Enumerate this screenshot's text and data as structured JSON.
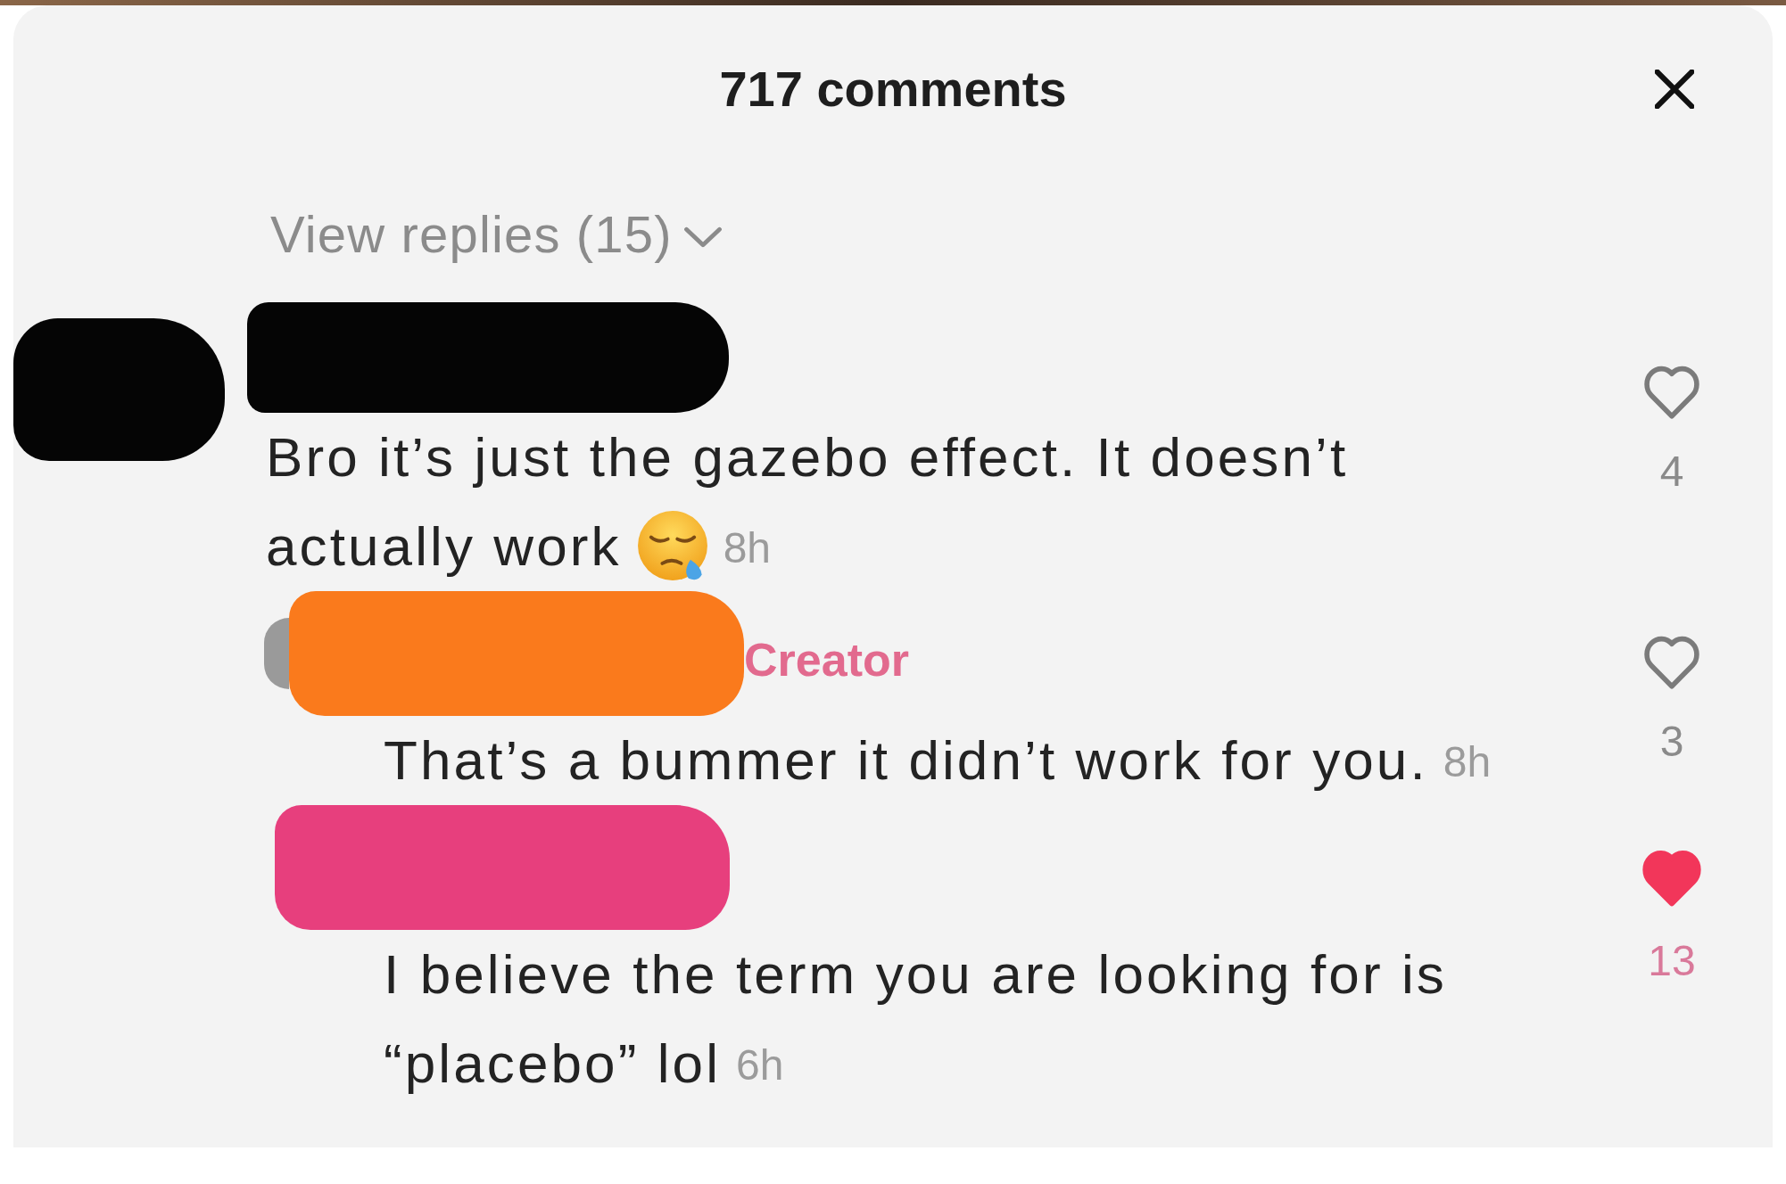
{
  "header": {
    "title": "717 comments"
  },
  "view_replies": "View replies (15)",
  "comments": [
    {
      "color": "#050505",
      "avatar_visible": false,
      "text_lines": [
        "Bro it’s just the gazebo effect. It doesn’t",
        "actually work"
      ],
      "emoji": true,
      "time": "8h",
      "likes": "4",
      "liked": false,
      "replies": [
        {
          "color": "#fa7a1c",
          "avatar_visible": true,
          "badge": "Creator",
          "text_lines": [
            "That’s a bummer it didn’t work for you."
          ],
          "emoji": false,
          "time": "8h",
          "likes": "3",
          "liked": false
        },
        {
          "color": "#e73f7d",
          "avatar_visible": false,
          "text_lines": [
            "I believe the term you are looking for is",
            "“placebo” lol"
          ],
          "emoji": false,
          "time": "6h",
          "likes": "13",
          "liked": true
        }
      ]
    }
  ]
}
